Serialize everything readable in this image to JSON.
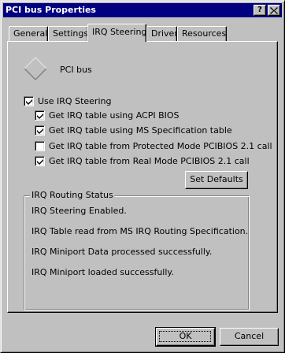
{
  "window": {
    "title": "PCI bus Properties",
    "help_glyph": "?",
    "close_glyph": "X"
  },
  "tabs": [
    {
      "label": "General",
      "active": false
    },
    {
      "label": "Settings",
      "active": false
    },
    {
      "label": "IRQ Steering",
      "active": true
    },
    {
      "label": "Driver",
      "active": false
    },
    {
      "label": "Resources",
      "active": false
    }
  ],
  "device": {
    "icon": "pci-bus-diamond-icon",
    "name": "PCI bus"
  },
  "checkboxes": {
    "use_irq_steering": {
      "label": "Use IRQ Steering",
      "checked": true
    },
    "acpi_bios": {
      "label": "Get IRQ table using ACPI BIOS",
      "checked": true
    },
    "ms_spec": {
      "label": "Get IRQ table using MS Specification table",
      "checked": true
    },
    "protected_mode": {
      "label": "Get IRQ table from Protected Mode PCIBIOS 2.1 call",
      "checked": false
    },
    "real_mode": {
      "label": "Get IRQ table from Real Mode PCIBIOS 2.1 call",
      "checked": true
    }
  },
  "set_defaults_label": "Set Defaults",
  "status": {
    "title": "IRQ Routing Status",
    "lines": [
      "IRQ Steering Enabled.",
      "IRQ Table read from MS IRQ Routing Specification.",
      "IRQ Miniport Data processed successfully.",
      "IRQ Miniport loaded successfully."
    ]
  },
  "buttons": {
    "ok": "OK",
    "cancel": "Cancel"
  }
}
